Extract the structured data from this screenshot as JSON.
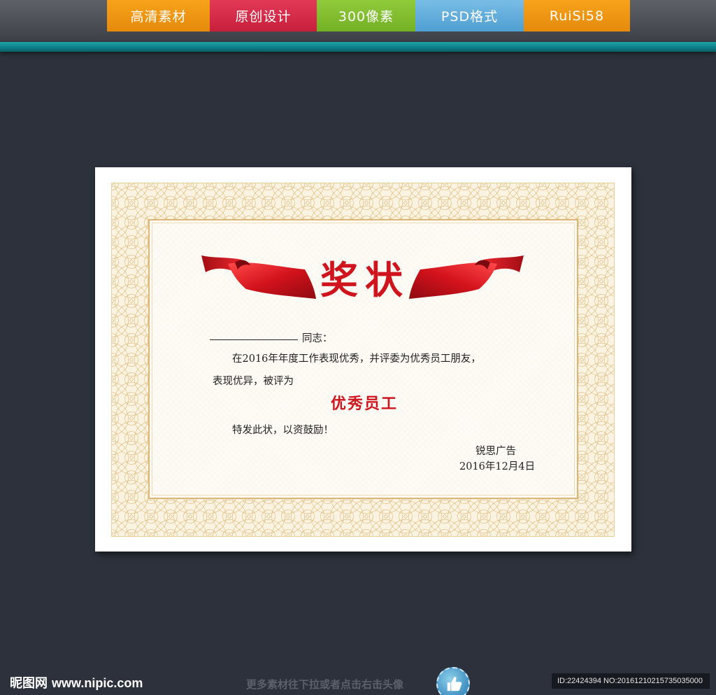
{
  "header": {
    "tabs": [
      {
        "label": "高清素材"
      },
      {
        "label": "原创设计"
      },
      {
        "label": "300像素"
      },
      {
        "label": "PSD格式"
      },
      {
        "label": "RuiSi58"
      }
    ]
  },
  "certificate": {
    "title": "奖状",
    "comrade_suffix": "同志：",
    "body_line1": "在2016年年度工作表现优秀，并评委为优秀员工朋友，",
    "body_line2": "表现优异，被评为",
    "award_title": "优秀员工",
    "closing": "特发此状，以资鼓励！",
    "issuer": "锐思广告",
    "date": "2016年12月4日"
  },
  "footer": {
    "logo_text": "昵图网",
    "site": "www.nipic.com",
    "hint": "更多素材往下拉或者点击右击头像",
    "id_text": "ID:22424394 NO:20161210215735035000"
  },
  "colors": {
    "accent_red": "#d0141d",
    "teal": "#0e8088",
    "background": "#2c313b"
  }
}
